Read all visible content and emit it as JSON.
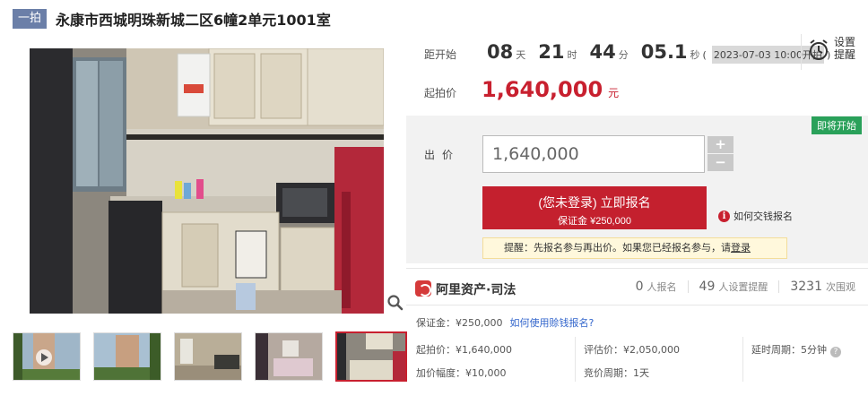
{
  "header": {
    "badge": "一拍",
    "title": "永康市西城明珠新城二区6幢2单元1001室"
  },
  "countdown": {
    "label": "距开始",
    "days": "08",
    "days_unit": "天",
    "hours": "21",
    "hours_unit": "时",
    "minutes": "44",
    "minutes_unit": "分",
    "seconds": "05.1",
    "seconds_unit": "秒",
    "start_paren_open": "(",
    "start_time": "2023-07-03 10:00开拍",
    "start_paren_close": ")"
  },
  "remind": {
    "line1": "设置",
    "line2": "提醒"
  },
  "start_price": {
    "label": "起拍价",
    "value": "1,640,000",
    "unit": "元"
  },
  "status_tag": "即将开始",
  "bid": {
    "label": "出价",
    "value": "1,640,000",
    "plus": "+",
    "minus": "−",
    "register_line1": "(您未登录) 立即报名",
    "register_line2": "保证金 ¥250,000",
    "howto": "如何交钱报名",
    "tip_text": "提醒：先报名参与再出价。如果您已经报名参与，请",
    "tip_link": "登录"
  },
  "platform": {
    "name": "阿里资产·司法",
    "stats": [
      {
        "value": "0",
        "label": "人报名"
      },
      {
        "value": "49",
        "label": "人设置提醒"
      },
      {
        "value": "3231",
        "label": "次围观"
      }
    ]
  },
  "details": {
    "deposit": "保证金：¥250,000",
    "deposit_link": "如何使用赊钱报名?",
    "start_price": "起拍价：¥1,640,000",
    "appraisal": "评估价：¥2,050,000",
    "extension": "延时周期：5分钟",
    "increment": "加价幅度：¥10,000",
    "cycle": "竞价周期：1天"
  },
  "gallery": {
    "thumb_count_shown": 5,
    "active_thumb": 5
  }
}
